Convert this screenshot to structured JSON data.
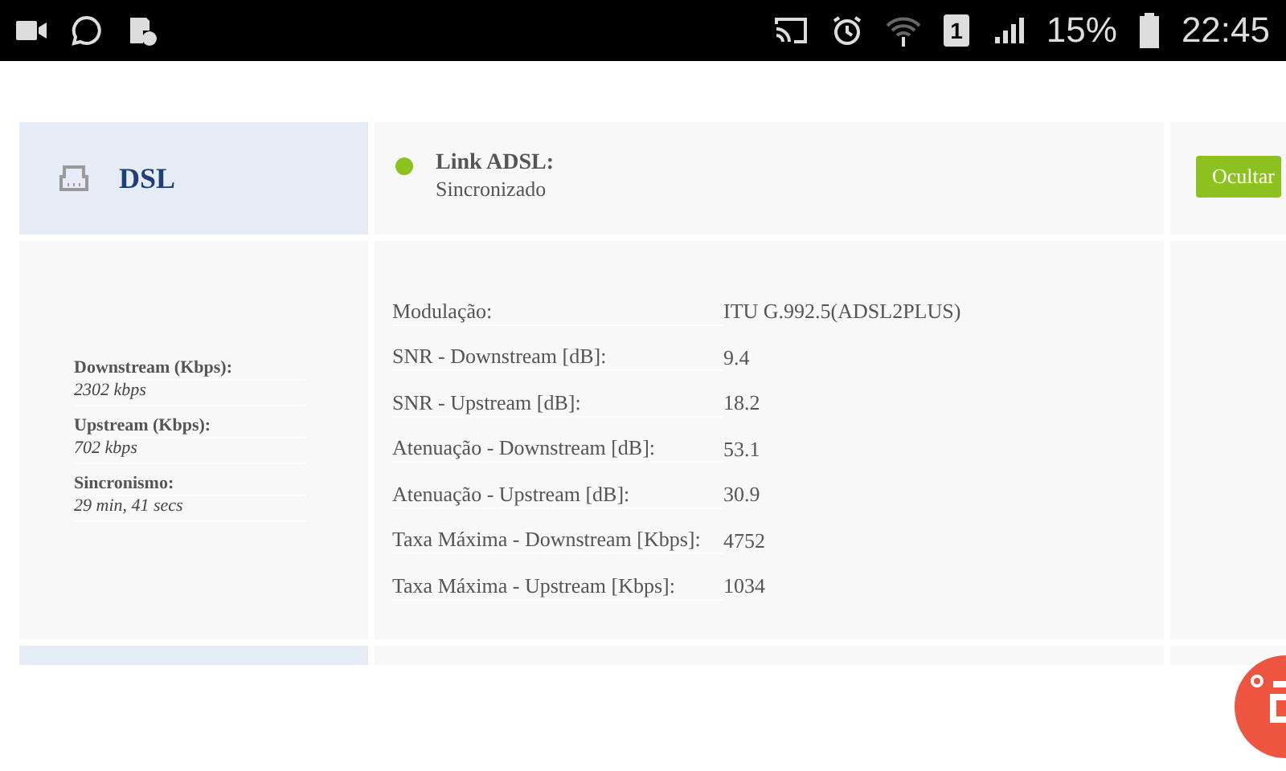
{
  "status_bar": {
    "sim_slot": "1",
    "battery": "15%",
    "time": "22:45"
  },
  "section": {
    "title": "DSL",
    "link": {
      "label": "Link ADSL:",
      "value": "Sincronizado",
      "color": "#8cc21f"
    },
    "hide_button": "Ocultar",
    "summary": [
      {
        "label": "Downstream (Kbps):",
        "value": "2302 kbps"
      },
      {
        "label": "Upstream (Kbps):",
        "value": "702 kbps"
      },
      {
        "label": "Sincronismo:",
        "value": "29 min, 41 secs"
      }
    ],
    "details": [
      {
        "label": "Modulação:",
        "value": "ITU G.992.5(ADSL2PLUS)"
      },
      {
        "label": "SNR - Downstream [dB]:",
        "value": "9.4"
      },
      {
        "label": "SNR - Upstream [dB]:",
        "value": "18.2"
      },
      {
        "label": "Atenuação - Downstream [dB]:",
        "value": "53.1"
      },
      {
        "label": "Atenuação - Upstream [dB]:",
        "value": "30.9"
      },
      {
        "label": "Taxa Máxima - Downstream [Kbps]:",
        "value": "4752"
      },
      {
        "label": "Taxa Máxima - Upstream [Kbps]:",
        "value": "1034"
      }
    ]
  }
}
